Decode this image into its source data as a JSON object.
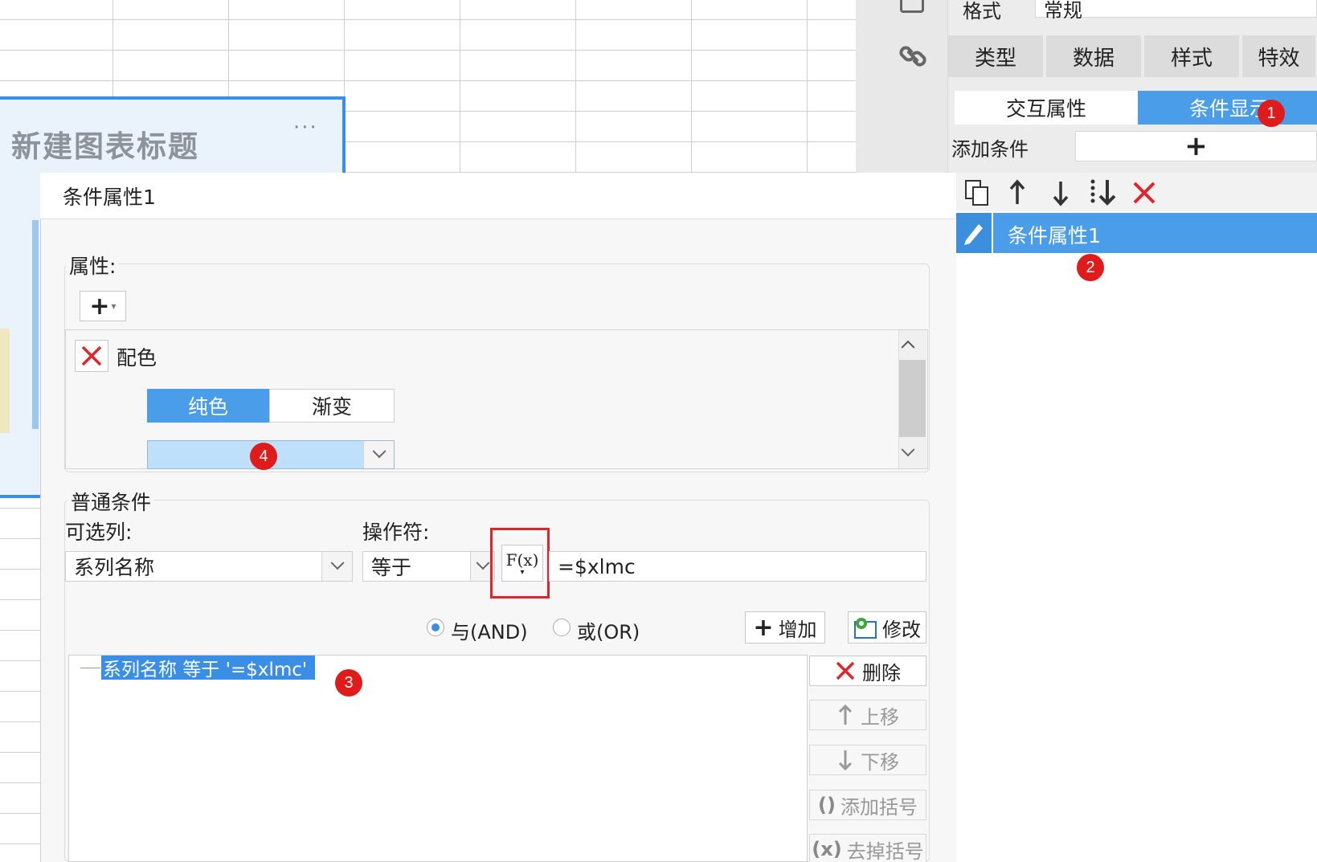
{
  "chart": {
    "title": "新建图表标题",
    "more": "···"
  },
  "right_panel": {
    "format_label": "格式",
    "format_value": "常规",
    "tabs": [
      "类型",
      "数据",
      "样式",
      "特效"
    ],
    "seg": [
      "交互属性",
      "条件显示"
    ],
    "add_condition_label": "添加条件",
    "add_symbol": "+",
    "list_item": "条件属性1",
    "badges": [
      "1",
      "2"
    ]
  },
  "dialog": {
    "title": "条件属性1",
    "attr_label": "属性:",
    "color_label": "配色",
    "color_tabs": [
      "纯色",
      "渐变"
    ],
    "color_swatch": "#bfe0fa",
    "badge4": "4",
    "common_label": "普通条件",
    "column_label": "可选列:",
    "column_value": "系列名称",
    "operator_label": "操作符:",
    "operator_value": "等于",
    "fx_label": "F(x)",
    "value": "=$xlmc",
    "and_label": "与(AND)",
    "or_label": "或(OR)",
    "add_btn": "增加",
    "modify_btn": "修改",
    "condition_item": "系列名称 等于 '=$xlmc'",
    "badge3": "3",
    "delete_btn": "删除",
    "up_btn": "上移",
    "down_btn": "下移",
    "add_bracket_btn": "添加括号",
    "remove_bracket_btn": "去掉括号"
  },
  "colors": {
    "accent": "#3a8ee6",
    "selected_row": "#4a9de8",
    "badge": "#e01b1b"
  }
}
